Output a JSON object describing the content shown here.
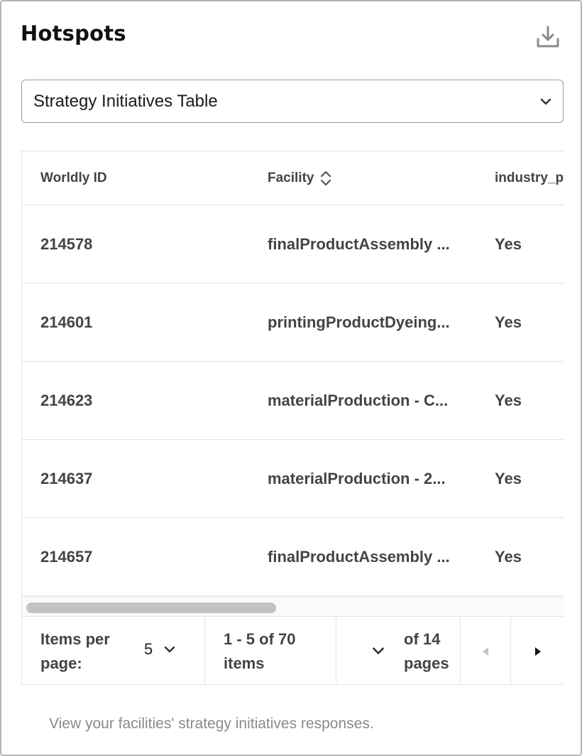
{
  "card": {
    "title": "Hotspots",
    "download_icon": "download-icon",
    "description": "View your facilities' strategy initiatives responses."
  },
  "selector": {
    "value": "Strategy Initiatives Table",
    "icon": "chevron-down-icon"
  },
  "table": {
    "columns": {
      "worldly_id": "Worldly ID",
      "facility": "Facility",
      "industry": "industry_p"
    },
    "sort_icon": "sort-updown-icon",
    "rows": [
      {
        "id": "214578",
        "facility": "finalProductAssembly ...",
        "industry": "Yes"
      },
      {
        "id": "214601",
        "facility": "printingProductDyeing...",
        "industry": "Yes"
      },
      {
        "id": "214623",
        "facility": "materialProduction - C...",
        "industry": "Yes"
      },
      {
        "id": "214637",
        "facility": "materialProduction - 2...",
        "industry": "Yes"
      },
      {
        "id": "214657",
        "facility": "finalProductAssembly ...",
        "industry": "Yes"
      }
    ],
    "horizontal_scroll_fraction": 0.46
  },
  "pagination": {
    "items_per_page_label": "Items per page:",
    "items_per_page_value": "5",
    "range_text": "1 - 5 of 70 items",
    "of_pages_text": "of 14 pages",
    "prev_icon": "triangle-left-icon",
    "next_icon": "triangle-right-icon"
  },
  "colors": {
    "border": "#b5b5b5",
    "text": "#444444",
    "muted": "#8a8a8a",
    "disabled_arrow": "#c4c4c4"
  }
}
